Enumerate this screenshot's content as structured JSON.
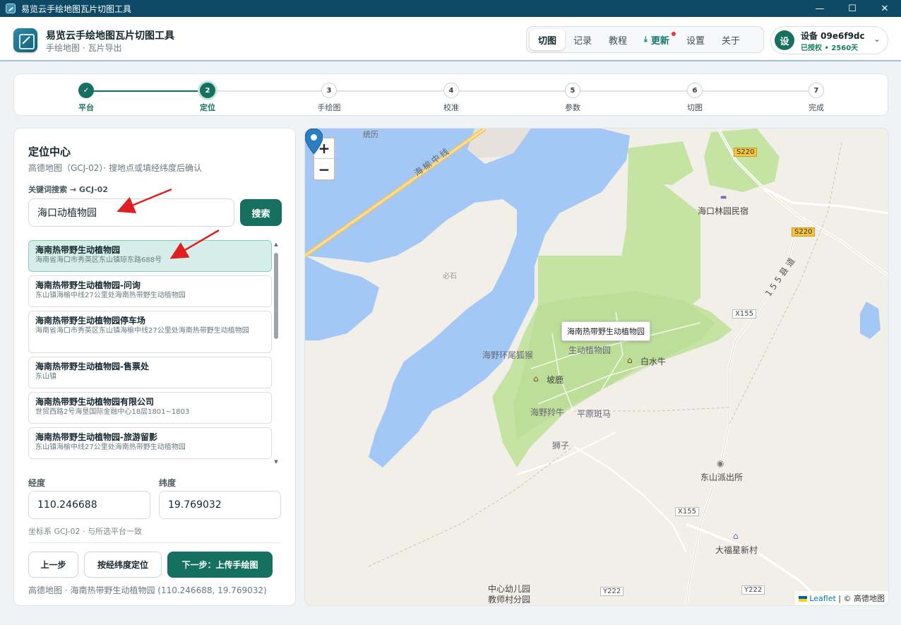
{
  "window": {
    "title": "易览云手绘地图瓦片切图工具",
    "controls": {
      "minimize": "—",
      "maximize": "☐",
      "close": "✕"
    }
  },
  "header": {
    "title": "易览云手绘地图瓦片切图工具",
    "subtitle": "手绘地图 · 瓦片导出",
    "nav": [
      {
        "label": "切图",
        "active": true
      },
      {
        "label": "记录"
      },
      {
        "label": "教程"
      },
      {
        "label": "更新",
        "has_dot": true
      },
      {
        "label": "设置"
      },
      {
        "label": "关于"
      }
    ],
    "device": {
      "avatar": "设",
      "name": "设备 09e6f9dc",
      "status": "已授权 • 2560天"
    }
  },
  "stepper": {
    "steps": [
      {
        "num": "✓",
        "label": "平台",
        "state": "done"
      },
      {
        "num": "2",
        "label": "定位",
        "state": "current"
      },
      {
        "num": "3",
        "label": "手绘图",
        "state": "todo"
      },
      {
        "num": "4",
        "label": "校准",
        "state": "todo"
      },
      {
        "num": "5",
        "label": "参数",
        "state": "todo"
      },
      {
        "num": "6",
        "label": "切图",
        "state": "todo"
      },
      {
        "num": "7",
        "label": "完成",
        "state": "todo"
      }
    ]
  },
  "panel": {
    "title": "定位中心",
    "subtitle": "高德地图（GCJ-02）· 搜地点或填经纬度后确认",
    "search_label": "关键词搜索 → GCJ-02",
    "search_value": "海口动植物园",
    "search_button": "搜索",
    "results": [
      {
        "name": "海南热带野生动植物园",
        "address": "海南省海口市秀英区东山镇琼东路688号",
        "selected": true
      },
      {
        "name": "海南热带野生动植物园-问询",
        "address": "东山镇海榆中线27公里处海南热带野生动植物园"
      },
      {
        "name": "海南热带野生动植物园停车场",
        "address": "海南省海口市秀英区东山镇海榆中线27公里处海南热带野生动植物园"
      },
      {
        "name": "海南热带野生动植物园-售票处",
        "address": "东山镇"
      },
      {
        "name": "海南热带野生动植物园有限公司",
        "address": "世贸西路2号海垦国际金融中心18层1801~1803"
      },
      {
        "name": "海南热带野生动植物园-旅游留影",
        "address": "东山镇海榆中线27公里处海南热带野生动植物园"
      }
    ],
    "lng_label": "经度",
    "lat_label": "纬度",
    "lng_value": "110.246688",
    "lat_value": "19.769032",
    "coord_note": "坐标系 GCJ-02 · 与所选平台一致",
    "buttons": {
      "prev": "上一步",
      "locate": "按经纬度定位",
      "next": "下一步：上传手绘图"
    },
    "footer": "高德地图 · 海南热带野生动植物园   (110.246688, 19.769032)"
  },
  "map": {
    "zoom_in": "+",
    "zoom_out": "−",
    "popup": "海南热带野生动植物园",
    "labels": {
      "tongli": "统历",
      "hwy": "海榆中线",
      "bishi": "必石",
      "s220_a": "S220",
      "s220_b": "S220",
      "minsu": "海口林园民宿",
      "x155_road": "155县道",
      "x155_a": "X155",
      "x155_b": "X155",
      "weizhi": "海野环尾狐猴",
      "dongzhi": "生动植物园",
      "baishuiniu": "白水牛",
      "polu": "坡鹿",
      "lingniu": "海野羚牛",
      "banma": "平原斑马",
      "shizi": "狮子",
      "paichusuo": "东山派出所",
      "cun": "大福星新村",
      "kindergarten_1": "中心幼儿园",
      "kindergarten_2": "教师村分园",
      "y222_a": "Y222",
      "y222_b": "Y222"
    },
    "attribution_leaflet": "Leaflet",
    "attribution_rest": " | © 高德地图"
  },
  "colors": {
    "accent": "#15705f",
    "water": "#a3c8f5",
    "park": "#c5e3a3",
    "land": "#f2efe9",
    "marker": "#2a7fc4",
    "annotation": "#e02020"
  }
}
